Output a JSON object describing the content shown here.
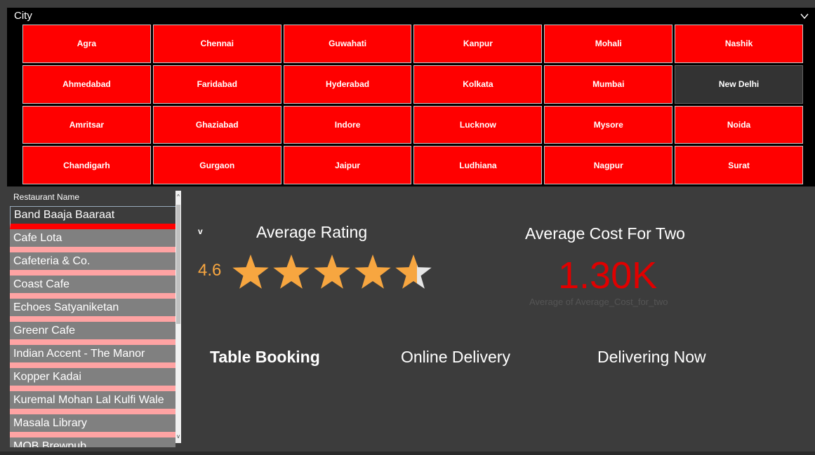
{
  "city_slicer": {
    "title": "City",
    "cities": [
      "Agra",
      "Chennai",
      "Guwahati",
      "Kanpur",
      "Mohali",
      "Nashik",
      "Ahmedabad",
      "Faridabad",
      "Hyderabad",
      "Kolkata",
      "Mumbai",
      "New Delhi",
      "Amritsar",
      "Ghaziabad",
      "Indore",
      "Lucknow",
      "Mysore",
      "Noida",
      "Chandigarh",
      "Gurgaon",
      "Jaipur",
      "Ludhiana",
      "Nagpur",
      "Surat"
    ],
    "selected": "New Delhi"
  },
  "restaurant_slicer": {
    "header": "Restaurant Name",
    "items": [
      "Band Baaja Baaraat",
      "Cafe Lota",
      "Cafeteria & Co.",
      "Coast Cafe",
      "Echoes Satyaniketan",
      "Greenr Cafe",
      "Indian Accent - The Manor",
      "Kopper Kadai",
      "Kuremal Mohan Lal Kulfi Wale",
      "Masala Library",
      "MOB Brewpub"
    ]
  },
  "rating": {
    "marker": "v",
    "title": "Average Rating",
    "value": "4.6",
    "stars_total": 5,
    "stars_filled": 4.6
  },
  "cost": {
    "title": "Average Cost For Two",
    "value": "1.30K",
    "subtitle": "Average of Average_Cost_for_two"
  },
  "toggles": {
    "table_booking": "Table Booking",
    "online_delivery": "Online Delivery",
    "delivering_now": "Delivering Now"
  },
  "colors": {
    "accent": "#ff0000",
    "selected": "#333333",
    "star": "#f7a640",
    "background": "#3c3c3c"
  }
}
